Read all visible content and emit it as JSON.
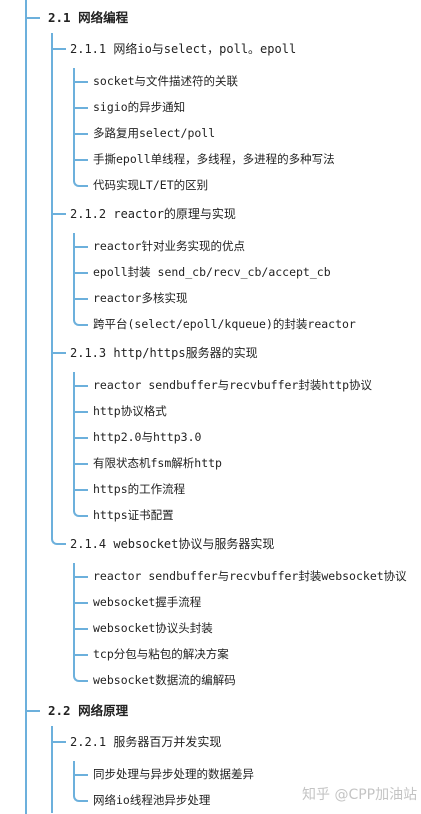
{
  "sections": [
    {
      "title": "2.1 网络编程",
      "subsections": [
        {
          "title": "2.1.1 网络io与select，poll。epoll",
          "items": [
            "socket与文件描述符的关联",
            "sigio的异步通知",
            "多路复用select/poll",
            "手撕epoll单线程，多线程，多进程的多种写法",
            "代码实现LT/ET的区别"
          ]
        },
        {
          "title": "2.1.2 reactor的原理与实现",
          "items": [
            "reactor针对业务实现的优点",
            "epoll封装 send_cb/recv_cb/accept_cb",
            "reactor多核实现",
            "跨平台(select/epoll/kqueue)的封装reactor"
          ]
        },
        {
          "title": "2.1.3 http/https服务器的实现",
          "items": [
            "reactor sendbuffer与recvbuffer封装http协议",
            "http协议格式",
            "http2.0与http3.0",
            "有限状态机fsm解析http",
            "https的工作流程",
            "https证书配置"
          ]
        },
        {
          "title": "2.1.4 websocket协议与服务器实现",
          "items": [
            "reactor sendbuffer与recvbuffer封装websocket协议",
            "websocket握手流程",
            "websocket协议头封装",
            "tcp分包与粘包的解决方案",
            "websocket数据流的编解码"
          ]
        }
      ]
    },
    {
      "title": "2.2 网络原理",
      "subsections": [
        {
          "title": "2.2.1 服务器百万并发实现",
          "items": [
            "同步处理与异步处理的数据差异",
            "网络io线程池异步处理"
          ]
        }
      ]
    }
  ],
  "watermark": "知乎 @CPP加油站",
  "colors": {
    "line": "#6cb0dc"
  }
}
